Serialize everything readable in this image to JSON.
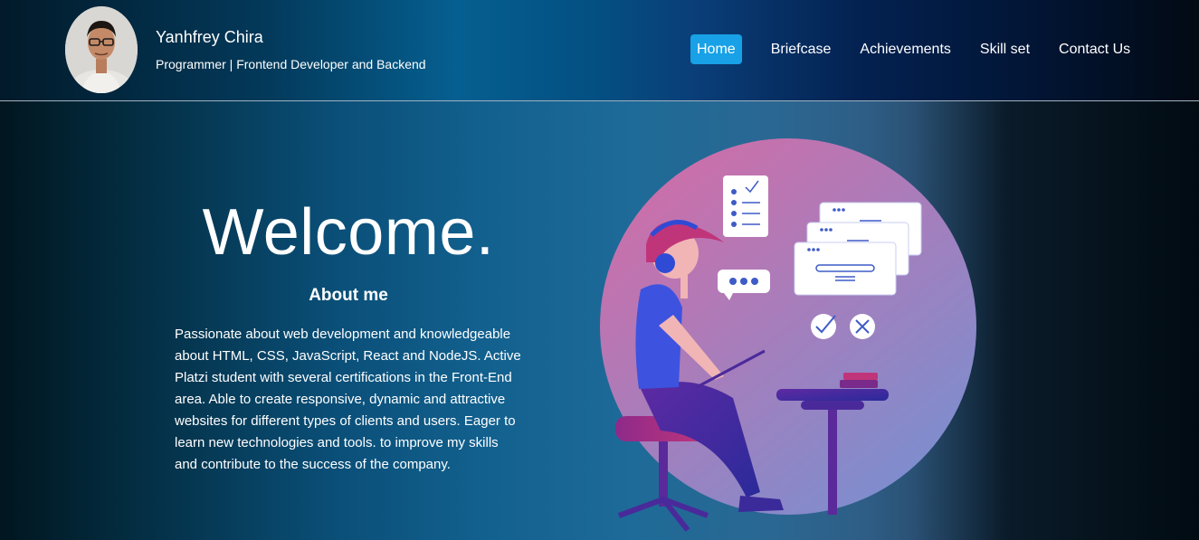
{
  "header": {
    "name": "Yanhfrey Chira",
    "subtitle": "Programmer | Frontend Developer and Backend"
  },
  "nav": {
    "items": [
      "Home",
      "Briefcase",
      "Achievements",
      "Skill set",
      "Contact Us"
    ],
    "active": "Home"
  },
  "hero": {
    "title": "Welcome.",
    "about_title": "About me",
    "about_text": "Passionate about web development and knowledgeable about HTML, CSS, JavaScript, React and NodeJS. Active Platzi student with several certifications in the Front-End area. Able to create responsive, dynamic and attractive websites for different types of clients and users. Eager to learn new technologies and tools. to improve my skills and contribute to the success of the company."
  },
  "colors": {
    "nav_active": "#18a1e6",
    "circle_top": "#d86aa4",
    "circle_bottom": "#7a8fd0"
  },
  "icons": [
    "avatar-photo",
    "developer-illustration",
    "checklist-icon",
    "chat-bubble-icon",
    "check-circle-icon",
    "close-circle-icon"
  ]
}
